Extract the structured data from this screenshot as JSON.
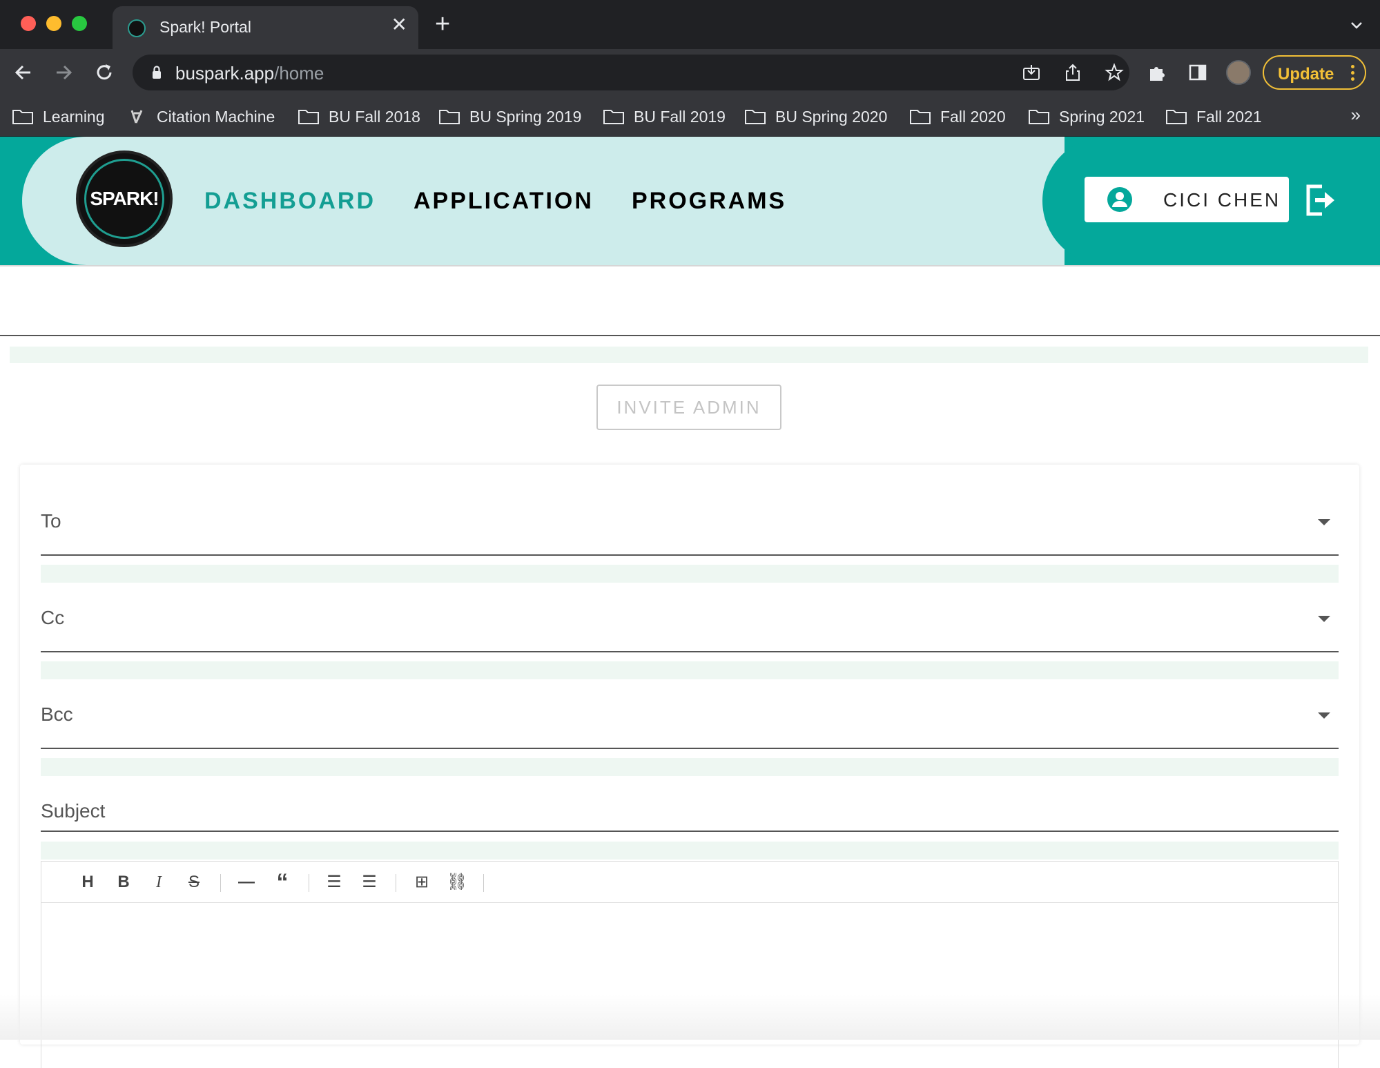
{
  "browser": {
    "tab_title": "Spark! Portal",
    "url_domain": "buspark.app",
    "url_path": "/home",
    "update_label": "Update",
    "bookmarks": [
      {
        "label": "Learning",
        "icon": "folder-icon"
      },
      {
        "label": "Citation Machine",
        "icon": "citation-machine-icon"
      },
      {
        "label": "BU Fall 2018",
        "icon": "folder-icon"
      },
      {
        "label": "BU Spring 2019",
        "icon": "folder-icon"
      },
      {
        "label": "BU Fall 2019",
        "icon": "folder-icon"
      },
      {
        "label": "BU Spring 2020",
        "icon": "folder-icon"
      },
      {
        "label": "Fall 2020",
        "icon": "folder-icon"
      },
      {
        "label": "Spring 2021",
        "icon": "folder-icon"
      },
      {
        "label": "Fall 2021",
        "icon": "folder-icon"
      }
    ],
    "bookmarks_overflow": "»"
  },
  "header": {
    "logo_text": "SPARK!",
    "nav": [
      {
        "label": "DASHBOARD",
        "active": true
      },
      {
        "label": "APPLICATION",
        "active": false
      },
      {
        "label": "PROGRAMS",
        "active": false
      }
    ],
    "user_name": "CICI CHEN",
    "colors": {
      "accent": "#04a89b",
      "header_bg": "#cdeceb",
      "active_nav": "#139e93"
    }
  },
  "main": {
    "invite_button": "INVITE ADMIN"
  },
  "compose": {
    "to_label": "To",
    "cc_label": "Cc",
    "bcc_label": "Bcc",
    "subject_label": "Subject",
    "toolbar": [
      {
        "name": "heading",
        "glyph": "H"
      },
      {
        "name": "bold",
        "glyph": "B"
      },
      {
        "name": "italic",
        "glyph": "I"
      },
      {
        "name": "strikethrough",
        "glyph": "S"
      },
      {
        "name": "horizontal-rule",
        "glyph": "—"
      },
      {
        "name": "quote",
        "glyph": "“"
      },
      {
        "name": "bullet-list",
        "glyph": "☰"
      },
      {
        "name": "numbered-list",
        "glyph": "☰"
      },
      {
        "name": "table",
        "glyph": "⊞"
      },
      {
        "name": "link",
        "glyph": "⛓"
      }
    ]
  }
}
